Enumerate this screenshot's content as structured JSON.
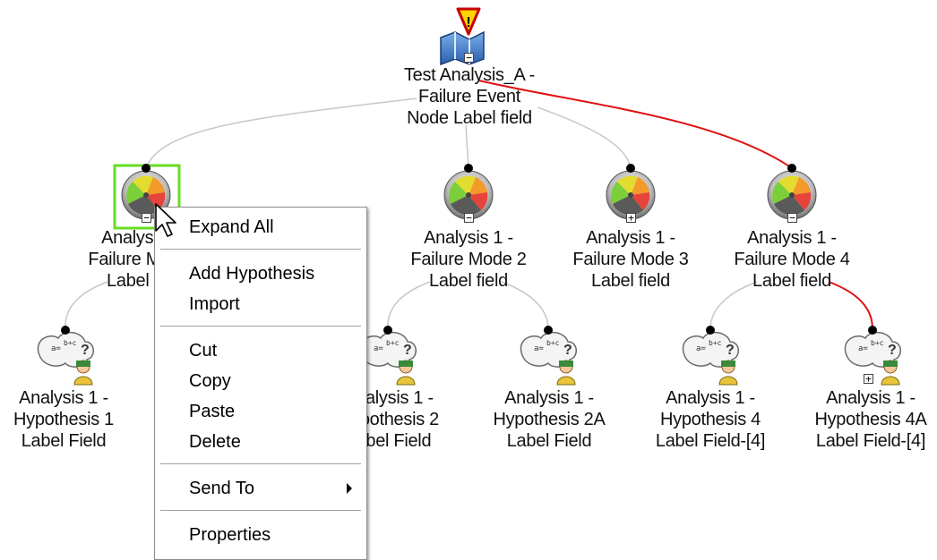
{
  "root": {
    "lines": [
      "Test Analysis_A  -",
      "Failure Event",
      "Node Label field"
    ]
  },
  "failure_modes": [
    {
      "lines": [
        "Analysis 1 -",
        "Failure Mode 1",
        "Label field"
      ]
    },
    {
      "lines": [
        "Analysis 1 -",
        "Failure Mode 2",
        "Label field"
      ]
    },
    {
      "lines": [
        "Analysis 1 -",
        "Failure Mode 3",
        "Label field"
      ]
    },
    {
      "lines": [
        "Analysis 1 -",
        "Failure Mode 4",
        "Label field"
      ]
    }
  ],
  "hypotheses": [
    {
      "lines": [
        "Analysis 1 -",
        "Hypothesis 1",
        "Label Field"
      ]
    },
    {
      "lines": [
        "Analysis 1 -",
        "Hypothesis 2",
        "Label Field"
      ]
    },
    {
      "lines": [
        "Analysis 1 -",
        "Hypothesis 2A",
        "Label Field"
      ]
    },
    {
      "lines": [
        "Analysis 1 -",
        "Hypothesis 4",
        "Label Field-[4]"
      ]
    },
    {
      "lines": [
        "Analysis 1 -",
        "Hypothesis 4A",
        "Label Field-[4]"
      ]
    }
  ],
  "context_menu": {
    "expand_all": "Expand All",
    "add_hypothesis": "Add Hypothesis",
    "import": "Import",
    "cut": "Cut",
    "copy": "Copy",
    "paste": "Paste",
    "delete": "Delete",
    "send_to": "Send To",
    "properties": "Properties"
  },
  "icons": {
    "root": "book-warning-icon",
    "failure_mode": "gauge-icon",
    "hypothesis": "hypothesis-thinker-icon",
    "expand": "minus-box-icon",
    "collapse": "plus-box-icon",
    "pointer": "mouse-pointer-icon"
  },
  "colors": {
    "connector": "#c8c8c8",
    "highlight_path": "#e01010",
    "selection": "#66dd22"
  },
  "expand_toggles": {
    "minus": "−",
    "plus": "+"
  }
}
